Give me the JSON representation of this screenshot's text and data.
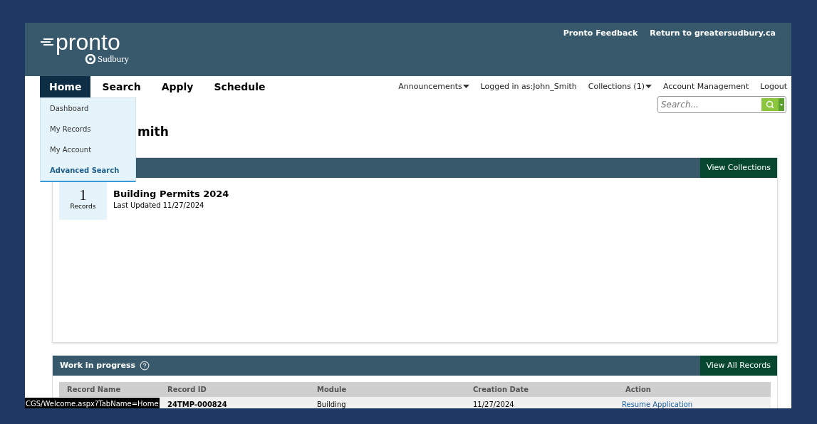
{
  "header": {
    "logo": "pronto",
    "sublogo": "Sudbury",
    "links": [
      "Pronto Feedback",
      "Return to greatersudbury.ca"
    ]
  },
  "nav": {
    "tabs": [
      {
        "label": "Home",
        "selected": true
      },
      {
        "label": "Search",
        "selected": false
      },
      {
        "label": "Apply",
        "selected": false
      },
      {
        "label": "Schedule",
        "selected": false
      }
    ],
    "menu": [
      {
        "label": "Dashboard",
        "selected": false
      },
      {
        "label": "My Records",
        "selected": false
      },
      {
        "label": "My Account",
        "selected": false
      },
      {
        "label": "Advanced Search",
        "selected": true
      }
    ],
    "links": [
      {
        "label": "Announcements",
        "dropdown": true
      },
      {
        "label": "Logged in as:John_Smith",
        "dropdown": false
      },
      {
        "label": "Collections (1)",
        "dropdown": true
      },
      {
        "label": "Account Management",
        "dropdown": false
      },
      {
        "label": "Logout",
        "dropdown": false
      }
    ]
  },
  "search": {
    "placeholder": "Search..."
  },
  "heading": "mith",
  "collections": {
    "button": "View Collections",
    "items": [
      {
        "count": "1",
        "count_label": "Records",
        "title": "Building Permits 2024",
        "updated": "Last Updated 11/27/2024"
      }
    ]
  },
  "work_in_progress": {
    "title": "Work in progress",
    "button": "View All Records",
    "columns": [
      "Record Name",
      "Record ID",
      "Module",
      "Creation Date",
      "Action"
    ],
    "rows": [
      {
        "cells": [
          "",
          "24TMP-000824",
          "Building",
          "11/27/2024"
        ],
        "action": "Resume Application"
      }
    ]
  },
  "status_bar": "CGS/Welcome.aspx?TabName=Home"
}
